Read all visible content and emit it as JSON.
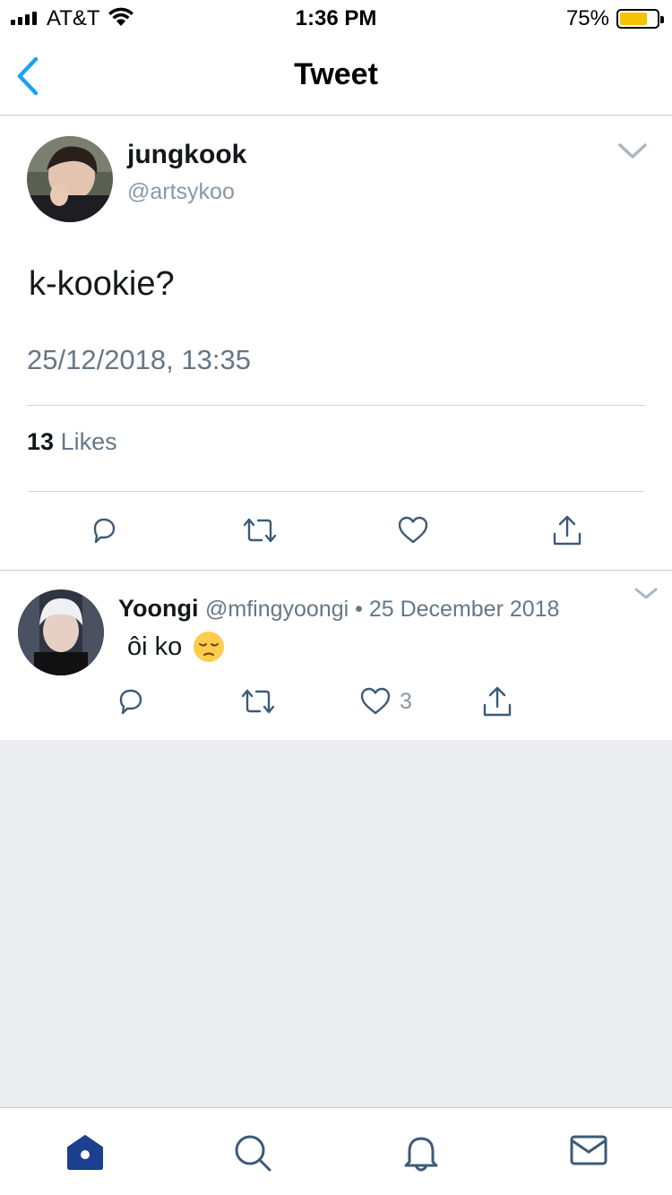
{
  "status_bar": {
    "carrier": "AT&T",
    "time": "1:36 PM",
    "battery": "75%",
    "battery_level": 0.75,
    "battery_color": "#f5c300"
  },
  "nav": {
    "back_icon": "chevron-left-icon",
    "title": "Tweet"
  },
  "tweet": {
    "display_name": "jungkook",
    "handle": "@artsykoo",
    "text": "k-kookie?",
    "timestamp": "25/12/2018, 13:35",
    "likes_count": "13",
    "likes_label": "Likes",
    "actions": [
      "reply-icon",
      "retweet-icon",
      "heart-icon",
      "share-icon"
    ]
  },
  "reply": {
    "display_name": "Yoongi",
    "meta": "@mfingyoongi • 25 December 2018",
    "text": "ôi ko",
    "emoji": "pensive-face-emoji",
    "like_count": "3",
    "actions": [
      "reply-icon",
      "retweet-icon",
      "heart-icon",
      "share-icon"
    ]
  },
  "tab_bar": {
    "items": [
      "home-icon",
      "search-icon",
      "bell-icon",
      "mail-icon"
    ],
    "active_color": "#1d3f8f"
  },
  "colors": {
    "accent": "#1da1f2",
    "secondary_text": "#657786",
    "background_gray": "#ebedf1"
  }
}
